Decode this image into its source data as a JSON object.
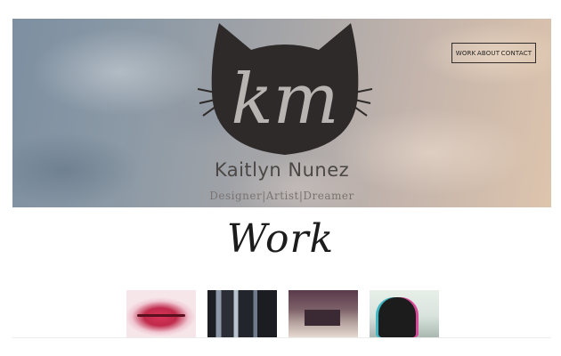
{
  "hero": {
    "name": "Kaitlyn Nunez",
    "tagline": "Designer|Artist|Dreamer",
    "logo_letters": "km"
  },
  "nav": {
    "items": [
      {
        "label": "WORK"
      },
      {
        "label": "ABOUT"
      },
      {
        "label": "CONTACT"
      }
    ]
  },
  "work": {
    "title": "Work",
    "thumbnails": [
      {
        "icon": "lips-artwork"
      },
      {
        "icon": "dark-window-artwork"
      },
      {
        "icon": "room-photo-artwork"
      },
      {
        "icon": "glitch-portrait-artwork"
      }
    ]
  },
  "colors": {
    "logo": "#2d2a29",
    "text": "#4a4744",
    "heading": "#1c1c1c"
  }
}
